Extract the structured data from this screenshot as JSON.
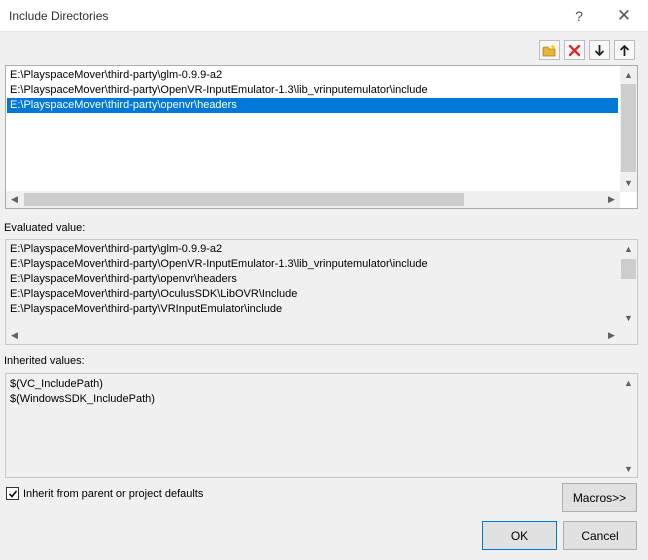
{
  "window": {
    "title": "Include Directories",
    "help_label": "?",
    "close_label": "✕"
  },
  "toolbar": {
    "new_line_icon": "folder-new-icon",
    "delete_icon": "delete-x-icon",
    "move_down_icon": "arrow-down-icon",
    "move_up_icon": "arrow-up-icon",
    "delete_color": "#d32f2f",
    "new_line_color": "#e8b33a"
  },
  "editor": {
    "lines": [
      "E:\\PlayspaceMover\\third-party\\glm-0.9.9-a2",
      "E:\\PlayspaceMover\\third-party\\OpenVR-InputEmulator-1.3\\lib_vrinputemulator\\include",
      "E:\\PlayspaceMover\\third-party\\openvr\\headers"
    ],
    "selected_index": 2,
    "selection_color": "#0078d7"
  },
  "evaluated": {
    "label": "Evaluated value:",
    "lines": [
      "E:\\PlayspaceMover\\third-party\\glm-0.9.9-a2",
      "E:\\PlayspaceMover\\third-party\\OpenVR-InputEmulator-1.3\\lib_vrinputemulator\\include",
      "E:\\PlayspaceMover\\third-party\\openvr\\headers",
      "E:\\PlayspaceMover\\third-party\\OculusSDK\\LibOVR\\Include",
      "E:\\PlayspaceMover\\third-party\\VRInputEmulator\\include"
    ]
  },
  "inherited": {
    "label": "Inherited values:",
    "lines": [
      "$(VC_IncludePath)",
      "$(WindowsSDK_IncludePath)"
    ]
  },
  "footer": {
    "inherit_label": "Inherit from parent or project defaults",
    "inherit_checked": true,
    "macros_label": "Macros>>",
    "ok_label": "OK",
    "cancel_label": "Cancel"
  }
}
